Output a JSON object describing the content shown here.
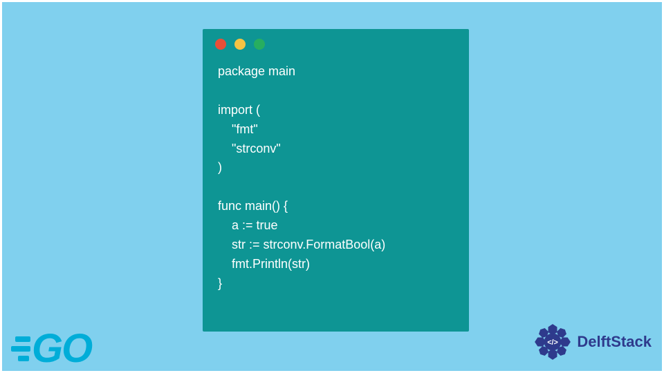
{
  "code": {
    "line1": "package main",
    "blank1": "",
    "line2": "import (",
    "line3": "    \"fmt\"",
    "line4": "    \"strconv\"",
    "line5": ")",
    "blank2": "",
    "line6": "func main() {",
    "line7": "    a := true",
    "line8": "    str := strconv.FormatBool(a)",
    "line9": "    fmt.Println(str)",
    "line10": "}"
  },
  "go_logo_text": "GO",
  "delft_brand": "DelftStack",
  "delft_badge_text": "</>"
}
